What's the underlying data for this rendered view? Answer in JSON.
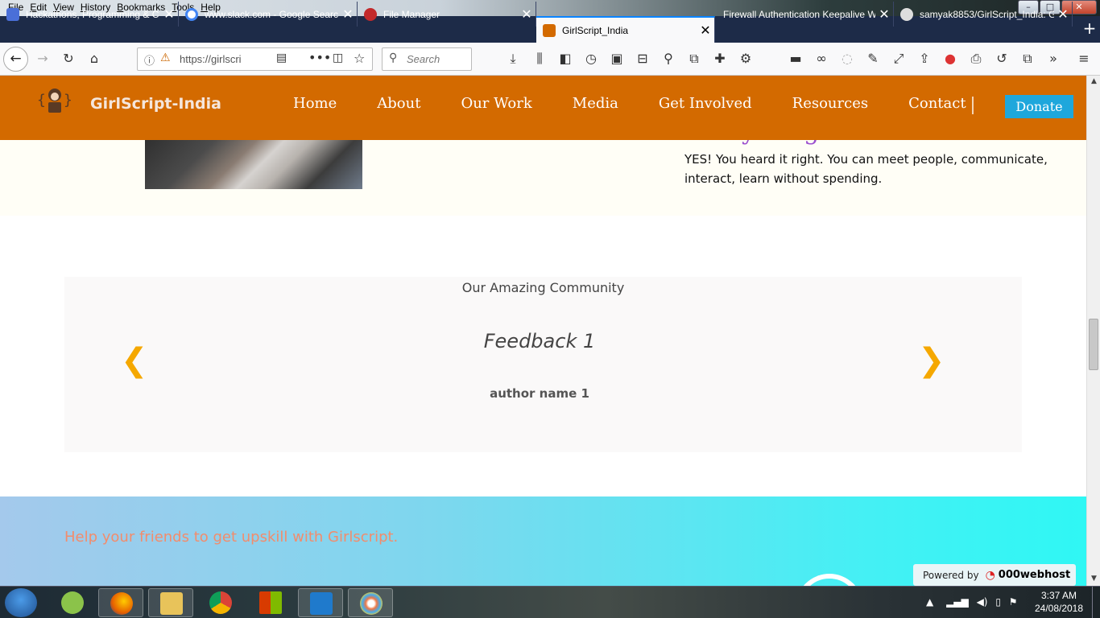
{
  "menubar": {
    "items": [
      "File",
      "Edit",
      "View",
      "History",
      "Bookmarks",
      "Tools",
      "Help"
    ]
  },
  "tabs": [
    {
      "label": "Hackathons, Programming & C",
      "favicon_color": "#4a6fd8"
    },
    {
      "label": "www.slack.com - Google Searc",
      "favicon_color": "#ffffff"
    },
    {
      "label": "File Manager",
      "favicon_color": "#c2292b"
    },
    {
      "label": "GirlScript_India",
      "favicon_color": "#d36a00"
    },
    {
      "label": "Firewall Authentication Keepalive W",
      "favicon_color": "#1d2b48"
    },
    {
      "label": "samyak8853/GirlScript_India: G",
      "favicon_color": "#cccccc"
    }
  ],
  "navbar": {
    "url": "https://girlscri",
    "search_placeholder": "Search"
  },
  "site": {
    "brand": "GirlScript-India",
    "nav": [
      "Home",
      "About",
      "Our Work",
      "Media",
      "Get Involved",
      "Resources",
      "Contact"
    ],
    "donate": "Donate",
    "free_heading": "Everything is Free!",
    "free_text": "YES! You heard it right. You can meet people, communicate, interact, learn without spending.",
    "community_title": "Our Amazing Community",
    "feedback_title": "Feedback 1",
    "feedback_author": "author name 1",
    "prev_arrow": "❮",
    "next_arrow": "❯",
    "cta_text": "Help your friends to get upskill with Girlscript.",
    "powered_by": "Powered by",
    "host": "000webhost"
  },
  "taskbar": {
    "time": "3:37 AM",
    "date": "24/08/2018"
  },
  "colors": {
    "header_orange": "#d36a00",
    "donate_blue": "#1ea7dc",
    "arrow_gold": "#f5a800",
    "heading_purple": "#9b4fcf",
    "tab_strip": "#1d2b48"
  }
}
